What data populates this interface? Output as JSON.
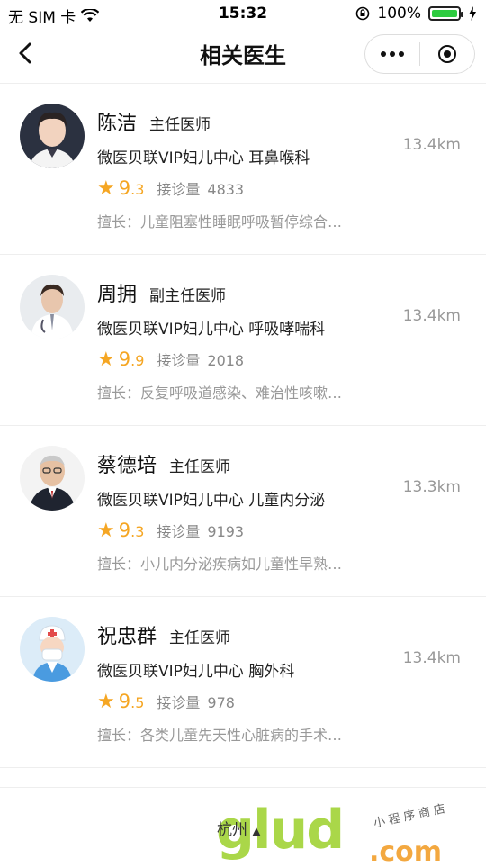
{
  "status_bar": {
    "carrier": "无 SIM 卡",
    "time": "15:32",
    "battery": "100%"
  },
  "nav": {
    "title": "相关医生"
  },
  "doctors": [
    {
      "name": "陈洁",
      "title": "主任医师",
      "department": "微医贝联VIP妇儿中心 耳鼻喉科",
      "distance": "13.4km",
      "rating_int": "9",
      "rating_dec": ".3",
      "consult_label": "接诊量",
      "consults": "4833",
      "specialty": "擅长：儿童阻塞性睡眠呼吸暂停综合…"
    },
    {
      "name": "周拥",
      "title": "副主任医师",
      "department": "微医贝联VIP妇儿中心 呼吸哮喘科",
      "distance": "13.4km",
      "rating_int": "9",
      "rating_dec": ".9",
      "consult_label": "接诊量",
      "consults": "2018",
      "specialty": "擅长：反复呼吸道感染、难治性咳嗽…"
    },
    {
      "name": "蔡德培",
      "title": "主任医师",
      "department": "微医贝联VIP妇儿中心 儿童内分泌",
      "distance": "13.3km",
      "rating_int": "9",
      "rating_dec": ".3",
      "consult_label": "接诊量",
      "consults": "9193",
      "specialty": "擅长：小儿内分泌疾病如儿童性早熟…"
    },
    {
      "name": "祝忠群",
      "title": "主任医师",
      "department": "微医贝联VIP妇儿中心 胸外科",
      "distance": "13.4km",
      "rating_int": "9",
      "rating_dec": ".5",
      "consult_label": "接诊量",
      "consults": "978",
      "specialty": "擅长：各类儿童先天性心脏病的手术…"
    }
  ],
  "bottom_bar": {
    "city": "杭州"
  },
  "watermark": {
    "brand": "glud",
    "domain": ".com",
    "slogan": "小程序商店"
  },
  "colors": {
    "accent_star": "#f5a623",
    "muted_text": "#999999",
    "divider": "#eeeeee"
  }
}
